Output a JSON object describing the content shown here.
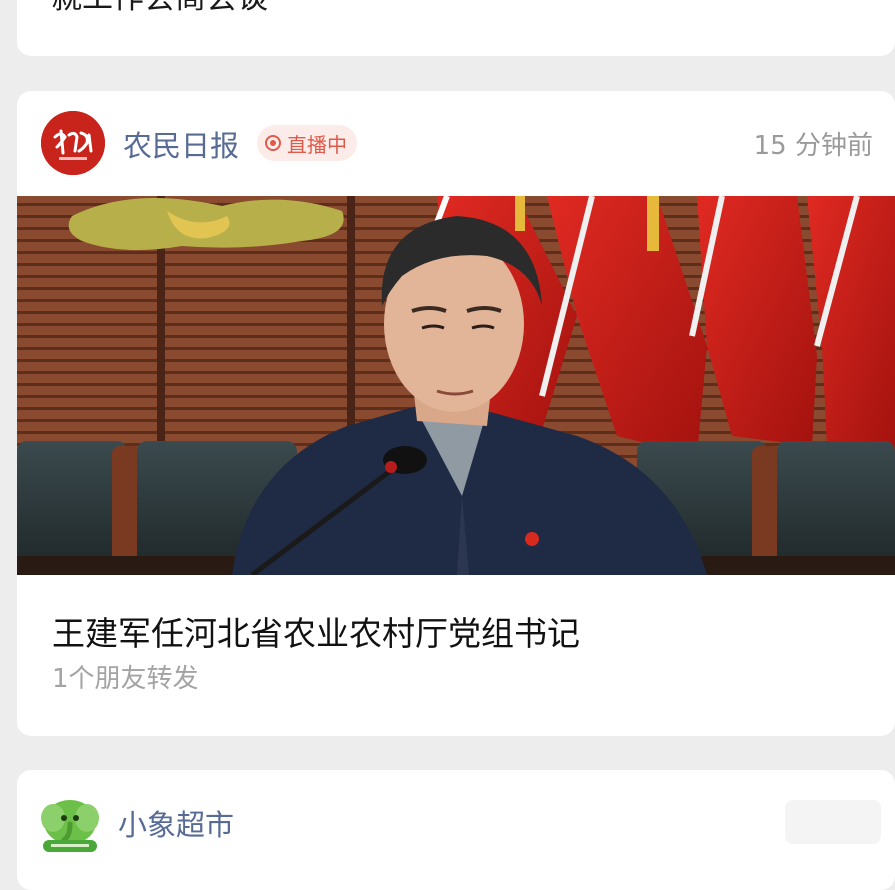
{
  "previous_item": {
    "title": "就工作会商会谈"
  },
  "feed_item": {
    "source_name": "农民日报",
    "source_avatar_icon": "nongmin-ribao-logo",
    "live_badge": "直播中",
    "timestamp": "15 分钟前",
    "cover_image": "news-photo",
    "headline": "王建军任河北省农业农村厅党组书记",
    "share_info": "1个朋友转发"
  },
  "next_item": {
    "source_name": "小象超市",
    "source_avatar_icon": "xiaoxiang-chaoshi-logo"
  },
  "colors": {
    "background": "#ededed",
    "card": "#ffffff",
    "source_link": "#576b95",
    "live_red": "#e05a4a",
    "secondary_text": "#9a9a9a",
    "logo_red": "#c9241c"
  }
}
